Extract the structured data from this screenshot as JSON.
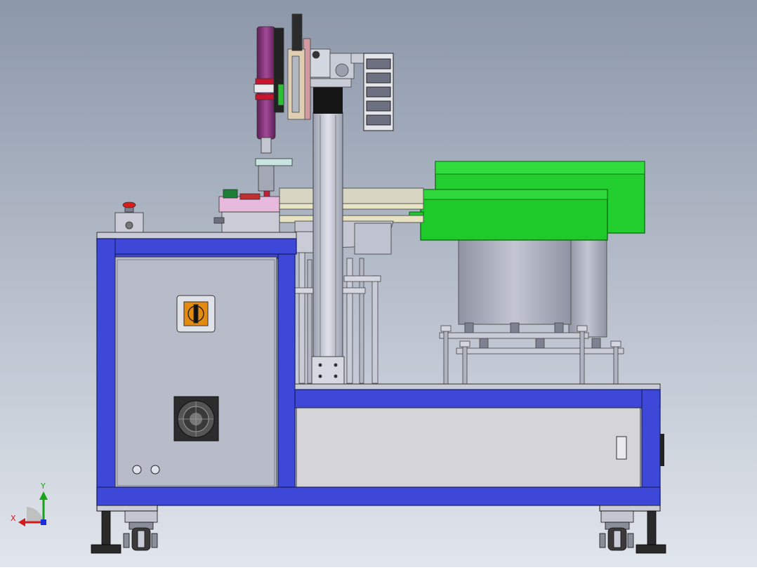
{
  "view": {
    "background_top": "#8c97a9",
    "background_bottom": "#dfe3ea"
  },
  "colors": {
    "frame_blue": "#3d48d8",
    "frame_edge": "#1a1f66",
    "panel_gray": "#b8bcc9",
    "bowl_green": "#1ecf2a",
    "bowl_gray": "#a9adbd",
    "motor_purple": "#8a2f7f",
    "pink_block": "#e9b7d8",
    "control_orange": "#e58a11",
    "estop_red": "#d81b1b"
  },
  "triad": {
    "x_label": "X",
    "y_label": "Y",
    "x_color": "#d21a1a",
    "y_color": "#19a319",
    "z_color": "#1a2fd8"
  }
}
